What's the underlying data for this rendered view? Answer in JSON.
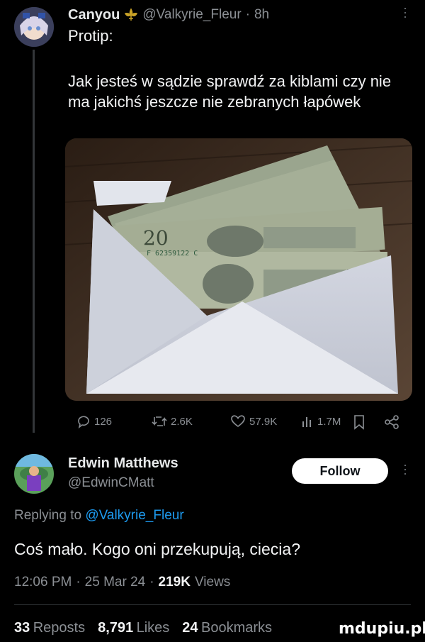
{
  "tweet": {
    "author_name": "Canyou",
    "author_handle": "@Valkyrie_Fleur",
    "time_ago": "8h",
    "separator": "·",
    "text_line1": "Protip:",
    "text_body": "Jak jesteś w sądzie sprawdź za kiblami czy nie ma jakichś jeszcze nie zebranych łapówek",
    "stats": {
      "replies": "126",
      "reposts": "2.6K",
      "likes": "57.9K",
      "views": "1.7M"
    }
  },
  "reply": {
    "author_name": "Edwin Matthews",
    "author_handle": "@EdwinCMatt",
    "follow_label": "Follow",
    "replying_prefix": "Replying to",
    "replying_handle": "@Valkyrie_Fleur",
    "text": "Coś mało. Kogo oni przekupują, ciecia?",
    "time": "12:06 PM",
    "date": "25 Mar 24",
    "views_count": "219K",
    "views_label": "Views",
    "reposts_count": "33",
    "reposts_label": "Reposts",
    "likes_count": "8,791",
    "likes_label": "Likes",
    "bookmarks_count": "24",
    "bookmarks_label": "Bookmarks"
  },
  "watermark": "mdupiu.pl",
  "icons": [
    "verified-fleur-icon",
    "more-dots-icon",
    "reply-icon",
    "repost-icon",
    "like-icon",
    "views-icon",
    "bookmark-icon",
    "share-icon"
  ]
}
